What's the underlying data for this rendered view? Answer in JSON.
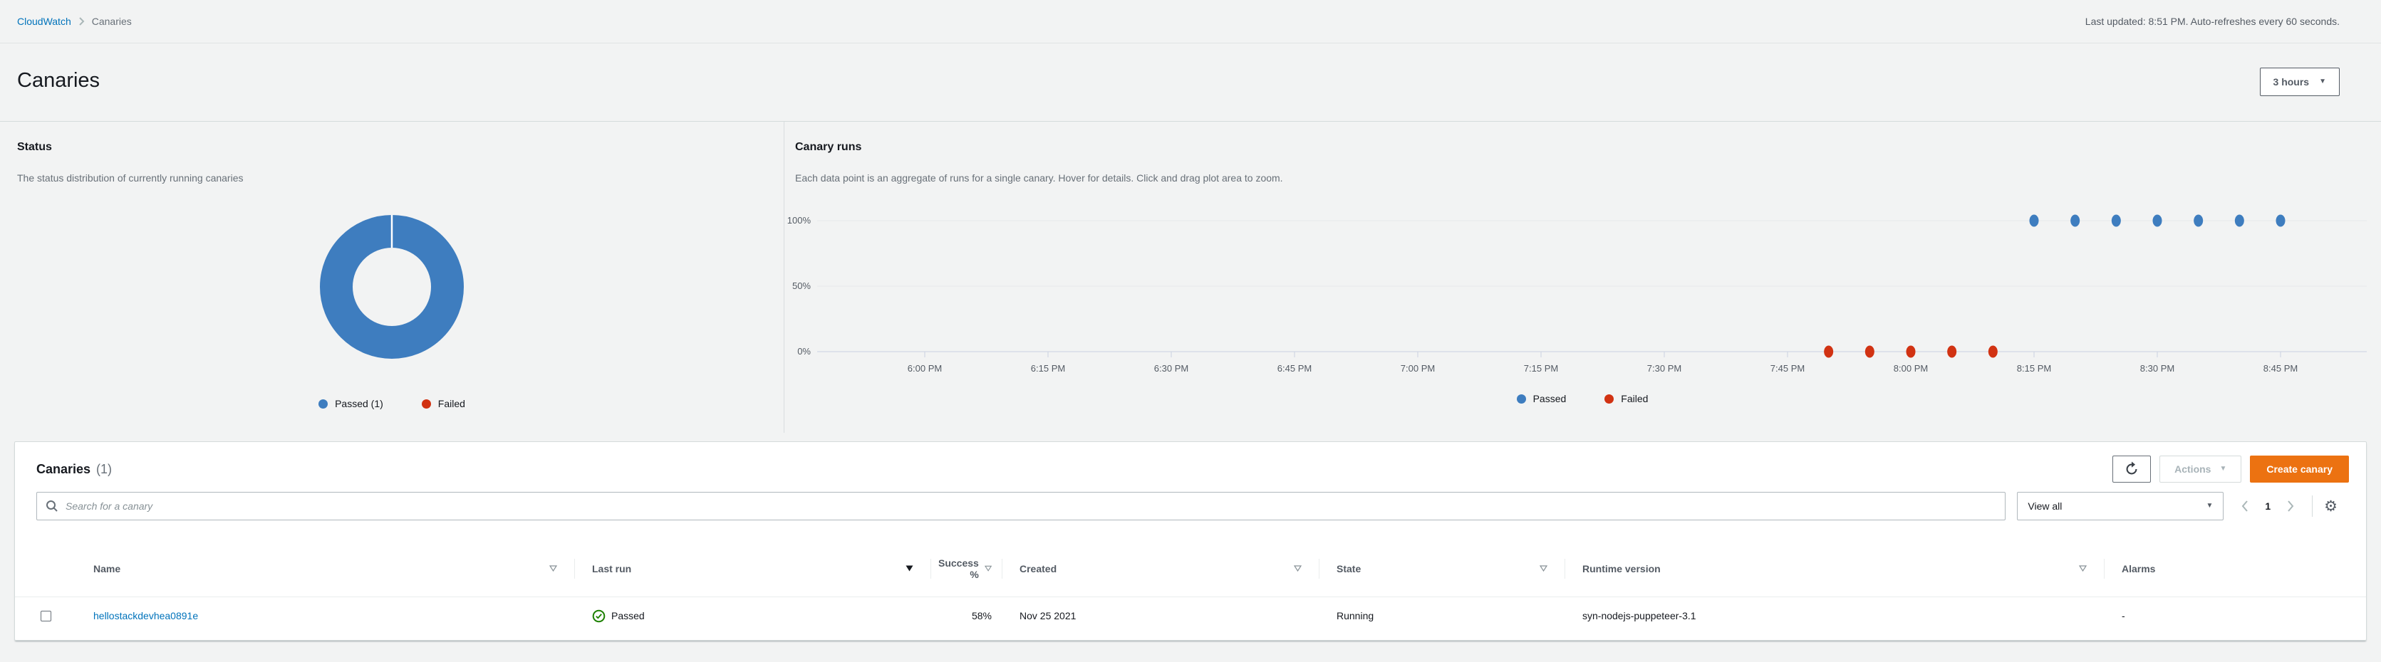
{
  "header": {
    "breadcrumb": [
      {
        "label": "CloudWatch"
      },
      {
        "label": "Canaries"
      }
    ],
    "last_updated": "Last updated: 8:51 PM. Auto-refreshes every 60 seconds.",
    "page_title": "Canaries",
    "time_range_label": "3 hours"
  },
  "status_panel": {
    "title": "Status",
    "description": "The status distribution of currently running canaries",
    "legend": [
      {
        "label": "Passed (1)"
      },
      {
        "label": "Failed"
      }
    ]
  },
  "runs_panel": {
    "title": "Canary runs",
    "description": "Each data point is an aggregate of runs for a single canary. Hover for details. Click and drag plot area to zoom.",
    "legend": [
      {
        "label": "Passed"
      },
      {
        "label": "Failed"
      }
    ]
  },
  "chart_data": [
    {
      "type": "pie",
      "title": "Status",
      "donut": true,
      "categories": [
        "Passed",
        "Failed"
      ],
      "values": [
        1,
        0
      ],
      "colors": [
        "#3e7dbf",
        "#d13212"
      ],
      "legend_position": "bottom"
    },
    {
      "type": "scatter",
      "title": "Canary runs",
      "xlabel": "",
      "ylabel": "",
      "ylim": [
        0,
        100
      ],
      "grid": true,
      "legend_position": "bottom",
      "y_ticks": [
        {
          "value": 100,
          "label": "100%"
        },
        {
          "value": 50,
          "label": "50%"
        },
        {
          "value": 0,
          "label": "0%"
        }
      ],
      "x_ticks": [
        "6:00 PM",
        "6:15 PM",
        "6:30 PM",
        "6:45 PM",
        "7:00 PM",
        "7:15 PM",
        "7:30 PM",
        "7:45 PM",
        "8:00 PM",
        "8:15 PM",
        "8:30 PM",
        "8:45 PM"
      ],
      "series": [
        {
          "name": "Passed",
          "color": "#3e7dbf",
          "points": [
            {
              "time": "8:15 PM",
              "min": 135,
              "y": 100
            },
            {
              "time": "8:20 PM",
              "min": 140,
              "y": 100
            },
            {
              "time": "8:25 PM",
              "min": 145,
              "y": 100
            },
            {
              "time": "8:30 PM",
              "min": 150,
              "y": 100
            },
            {
              "time": "8:35 PM",
              "min": 155,
              "y": 100
            },
            {
              "time": "8:40 PM",
              "min": 160,
              "y": 100
            },
            {
              "time": "8:45 PM",
              "min": 165,
              "y": 100
            }
          ]
        },
        {
          "name": "Failed",
          "color": "#d13212",
          "points": [
            {
              "time": "7:50 PM",
              "min": 110,
              "y": 0
            },
            {
              "time": "7:55 PM",
              "min": 115,
              "y": 0
            },
            {
              "time": "8:00 PM",
              "min": 120,
              "y": 0
            },
            {
              "time": "8:05 PM",
              "min": 125,
              "y": 0
            },
            {
              "time": "8:10 PM",
              "min": 130,
              "y": 0
            }
          ]
        }
      ]
    }
  ],
  "canaries_table": {
    "title": "Canaries",
    "count": "(1)",
    "actions_label": "Actions",
    "create_label": "Create canary",
    "search_placeholder": "Search for a canary",
    "view_filter_value": "View all",
    "page_number": "1",
    "columns": [
      {
        "label": "",
        "sort": "none"
      },
      {
        "label": "Name",
        "sort": "sortable"
      },
      {
        "label": "Last run",
        "sort": "desc"
      },
      {
        "label": "Success %",
        "sort": "sortable"
      },
      {
        "label": "Created",
        "sort": "sortable"
      },
      {
        "label": "State",
        "sort": "sortable"
      },
      {
        "label": "Runtime version",
        "sort": "sortable"
      },
      {
        "label": "Alarms",
        "sort": "none"
      }
    ],
    "rows": [
      {
        "name": "hellostackdevhea0891e",
        "last_run": "Passed",
        "success": "58%",
        "created": "Nov 25 2021",
        "state": "Running",
        "runtime_version": "syn-nodejs-puppeteer-3.1",
        "alarms": "-"
      }
    ]
  },
  "colors": {
    "page_background": "#f2f3f3",
    "accent_orange": "#ec7211",
    "link_blue": "#0073bb",
    "chart_passed_blue": "#3e7dbf",
    "chart_failed_red": "#d13212",
    "success_green": "#1d8102"
  }
}
